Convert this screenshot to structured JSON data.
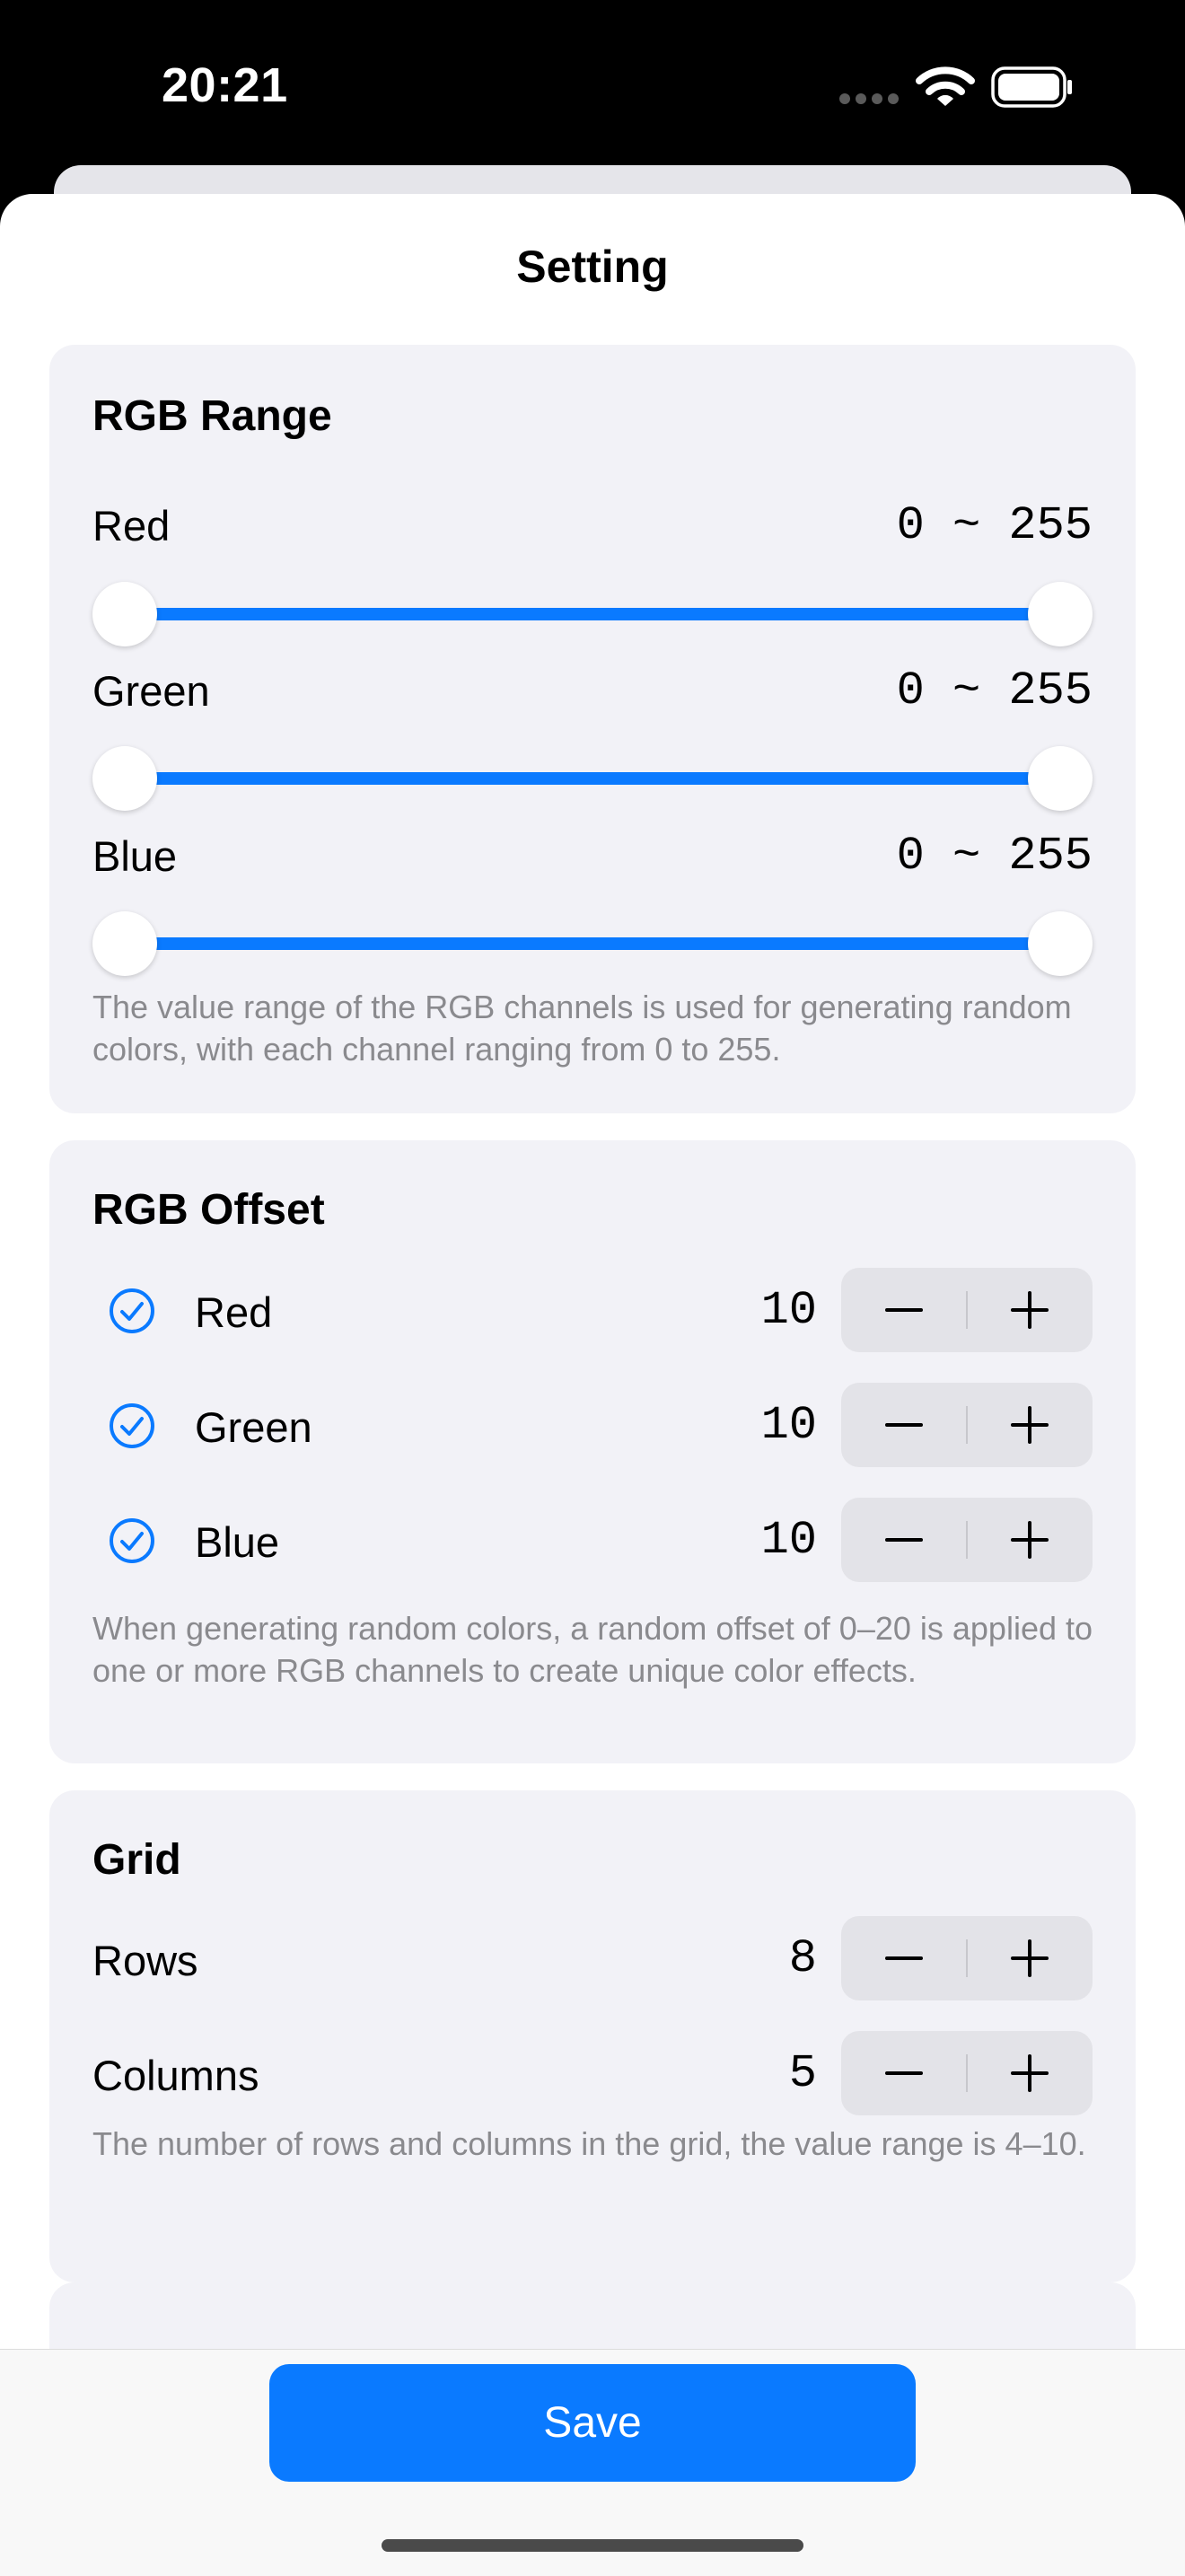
{
  "status_bar": {
    "time": "20:21"
  },
  "sheet": {
    "title": "Setting"
  },
  "rgb_range": {
    "title": "RGB Range",
    "channels": [
      {
        "label": "Red",
        "range_text": "0 ~ 255",
        "min": 0,
        "max": 255
      },
      {
        "label": "Green",
        "range_text": "0 ~ 255",
        "min": 0,
        "max": 255
      },
      {
        "label": "Blue",
        "range_text": "0 ~ 255",
        "min": 0,
        "max": 255
      }
    ],
    "footnote": "The value range of the RGB channels is used for generating random colors, with each channel ranging from 0 to 255."
  },
  "rgb_offset": {
    "title": "RGB Offset",
    "channels": [
      {
        "label": "Red",
        "value": "10",
        "checked": true
      },
      {
        "label": "Green",
        "value": "10",
        "checked": true
      },
      {
        "label": "Blue",
        "value": "10",
        "checked": true
      }
    ],
    "footnote": "When generating random colors, a random offset of 0–20 is applied to one or more RGB channels to create unique color effects."
  },
  "grid": {
    "title": "Grid",
    "rows_label": "Rows",
    "rows_value": "8",
    "columns_label": "Columns",
    "columns_value": "5",
    "footnote": "The number of rows and columns in the grid, the value range is 4–10."
  },
  "footer": {
    "save_label": "Save"
  },
  "colors": {
    "accent": "#0a7aff",
    "card_bg": "#f2f2f7",
    "stepper_bg": "#e3e3e8",
    "footnote": "#8a8a8e"
  },
  "icons": {
    "check": "checkmark-circle-icon",
    "minus": "minus-icon",
    "plus": "plus-icon",
    "wifi": "wifi-icon",
    "battery": "battery-icon",
    "cellular": "cellular-signal-icon"
  }
}
